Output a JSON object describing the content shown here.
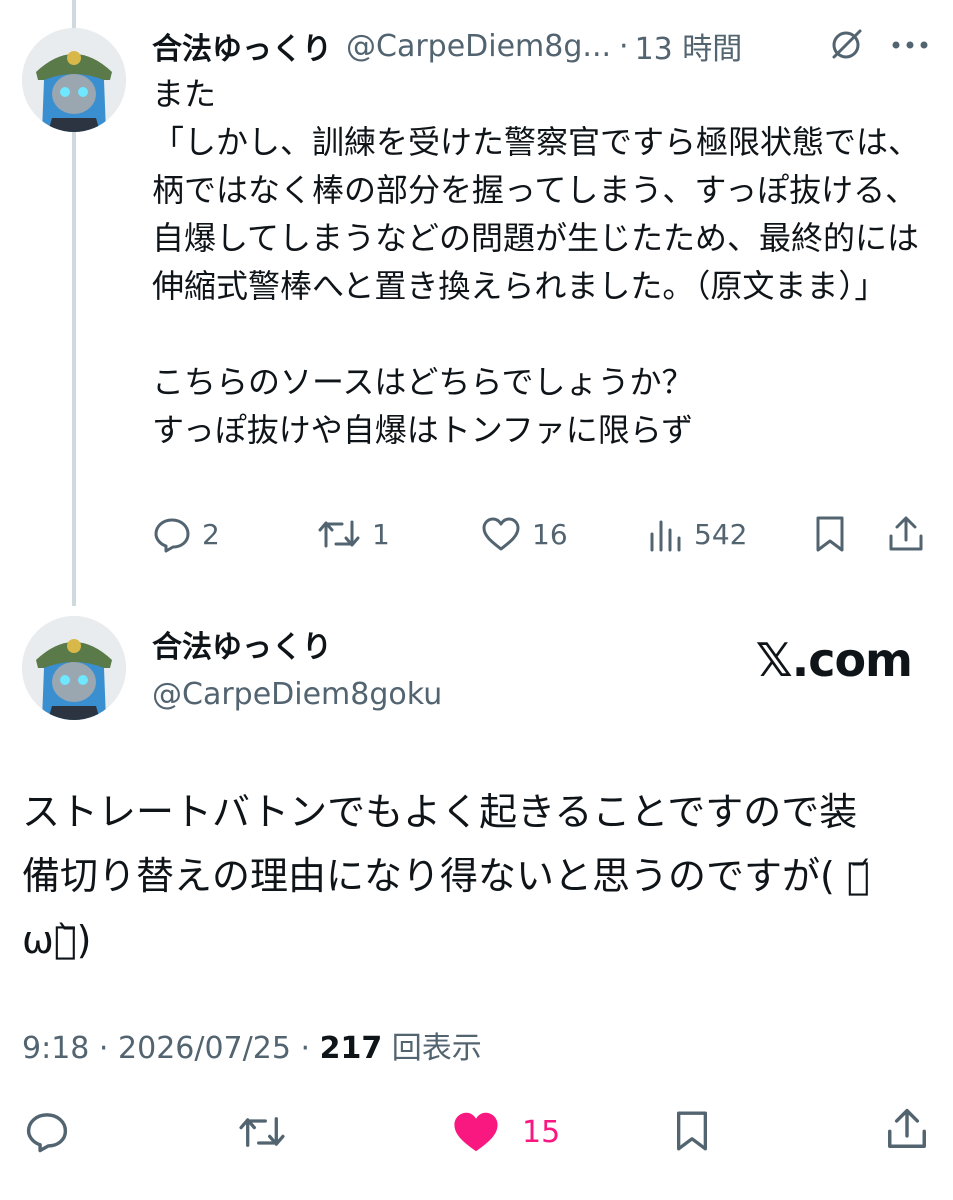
{
  "reply_tweet": {
    "display_name": "合法ゆっくり",
    "handle": "@CarpeDiem8g...",
    "separator": "·",
    "time": "13 時間",
    "text": "また\n「しかし、訓練を受けた警察官ですら極限状態では、柄ではなく棒の部分を握ってしまう、すっぽ抜ける、自爆してしまうなどの問題が生じたため、最終的には伸縮式警棒へと置き換えられました。（原文まま）」\n\nこちらのソースはどちらでしょうか？\nすっぽ抜けや自爆はトンファに限らず",
    "actions": {
      "replies": "2",
      "reposts": "1",
      "likes": "16",
      "views": "542"
    },
    "icons": [
      "grok-icon",
      "more-icon",
      "reply-icon",
      "repost-icon",
      "like-icon",
      "views-icon",
      "bookmark-icon",
      "share-icon"
    ]
  },
  "main_tweet": {
    "display_name": "合法ゆっくり",
    "handle": "@CarpeDiem8goku",
    "brand": "𝕏.com",
    "text": "ストレートバトンでもよく起きることですので装\n備切り替えの理由になり得ないと思うのですが( ･᷄\nω･᷅)",
    "time": "9:18",
    "date": "2026/07/25",
    "views_count": "217",
    "views_label": "回表示",
    "separator": "·",
    "likes": "15",
    "liked": true,
    "like_color": "#f91880",
    "icons": [
      "reply-icon",
      "repost-icon",
      "like-icon-filled",
      "bookmark-icon",
      "share-icon"
    ]
  }
}
